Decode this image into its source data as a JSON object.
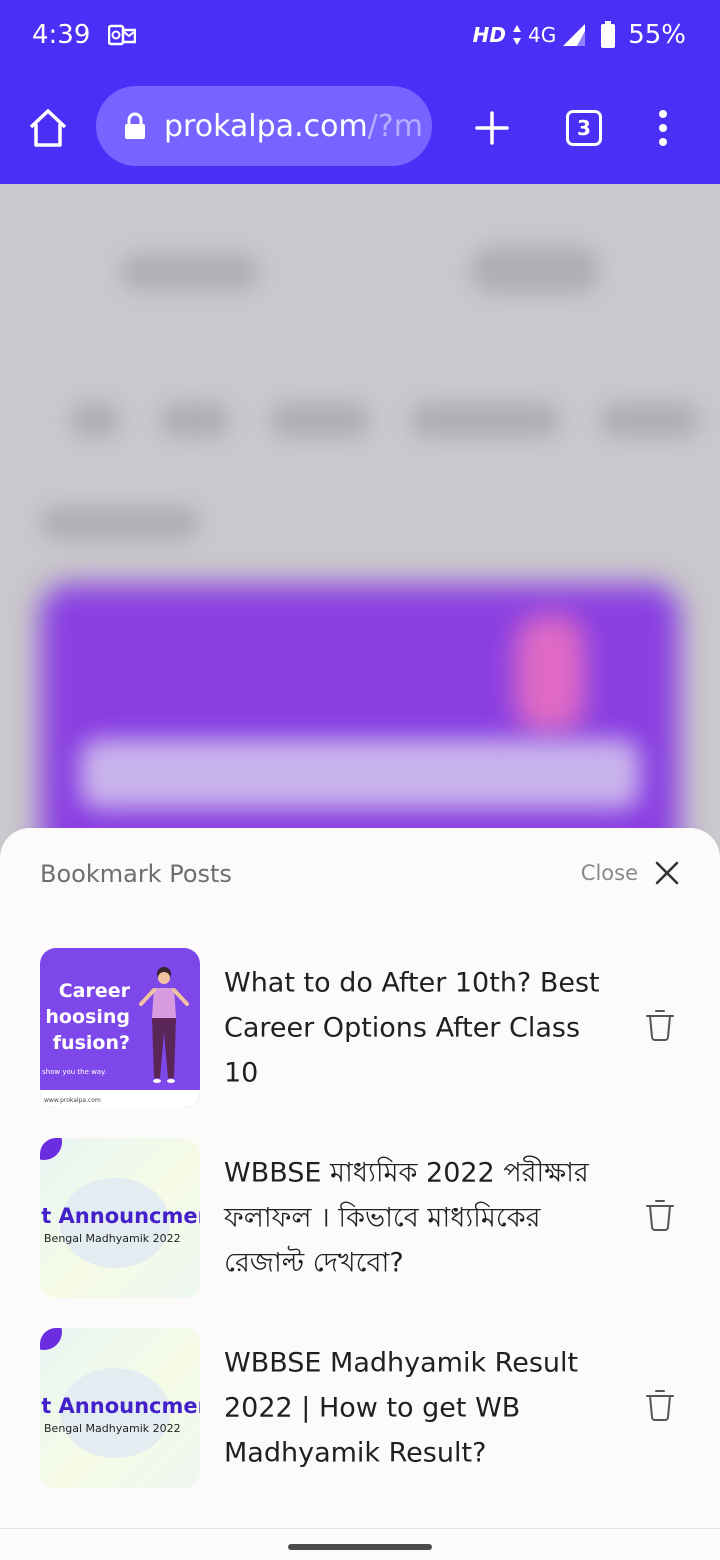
{
  "status_bar": {
    "time": "4:39",
    "hd": "HD",
    "network": "4G",
    "battery": "55%"
  },
  "browser": {
    "url_host": "prokalpa.com",
    "url_path": "/?m",
    "tab_count": "3"
  },
  "sheet": {
    "title": "Bookmark Posts",
    "close_label": "Close",
    "items": [
      {
        "title": "What to do After 10th? Best Career Options After Class 10",
        "thumb_text": "Career\nhoosing\nfusion?",
        "thumb_sub": "show you the way.",
        "thumb_url": "www.prokalpa.com"
      },
      {
        "title": "WBBSE মাধ্যমিক 2022 পরীক্ষার ফলাফল । কিভাবে মাধ্যমিকের রেজাল্ট দেখবো?",
        "thumb_text": "lt Announcmer",
        "thumb_sub": "Bengal Madhyamik 2022"
      },
      {
        "title": "WBBSE Madhyamik Result 2022 | How to get WB Madhyamik Result?",
        "thumb_text": "lt Announcmer",
        "thumb_sub": "Bengal Madhyamik 2022"
      }
    ]
  },
  "colors": {
    "browser_bar": "#4b2ff7",
    "url_pill": "#7763ff",
    "sheet_bg": "#fcfbf9",
    "thumb_purple": "#7e47ea"
  }
}
